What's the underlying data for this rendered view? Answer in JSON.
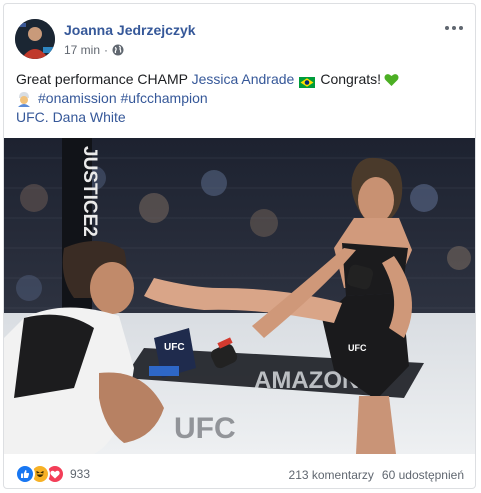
{
  "post": {
    "author": "Joanna Jedrzejczyk",
    "time": "17 min",
    "separator": "·",
    "privacy_icon": "globe-icon",
    "more_icon": "more-options-icon"
  },
  "content": {
    "line1_prefix": "Great performance CHAMP ",
    "line1_tag": "Jessica Andrade",
    "line1_flag": "brazil-flag-icon",
    "line1_suffix": "Congrats!",
    "line1_emoji": "green-heart-icon",
    "line2_emoji": "woman-in-turban-emoji",
    "hashtag1": "#onamission",
    "hashtag2": "#ufcchampion",
    "tag_ufc": "UFC.",
    "tag_dana": "Dana White"
  },
  "photo": {
    "pillar_text": "JUSTICE2",
    "glove_text": "UFC",
    "shorts_text": "UFC",
    "mat_text": "UFC",
    "mat_text2": "AMAZON"
  },
  "footer": {
    "reaction_icons": [
      "like-icon",
      "haha-icon",
      "love-icon"
    ],
    "reaction_count": "933",
    "comments": "213 komentarzy",
    "shares": "60 udostępnień"
  },
  "colors": {
    "link": "#365899",
    "meta_text": "#616770",
    "like": "#1877f2",
    "haha": "#f7b125",
    "love": "#f33e58"
  }
}
